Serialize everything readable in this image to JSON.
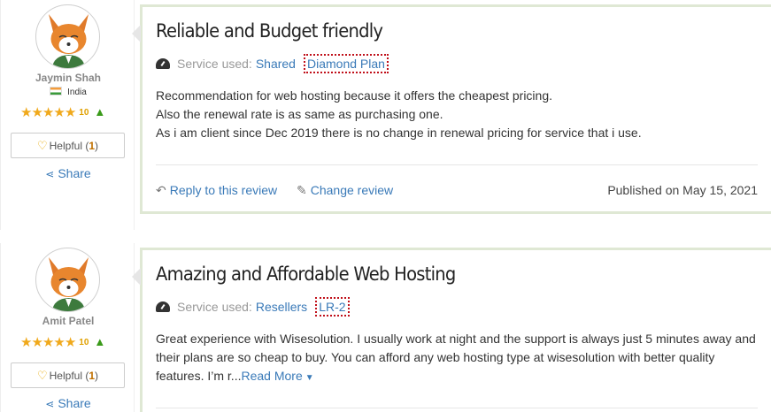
{
  "reviews": [
    {
      "user": {
        "name": "Jaymin Shah",
        "country": "India",
        "rating_count": "10"
      },
      "helpful": {
        "label": "Helpful (",
        "count": "1",
        "close": ")"
      },
      "share_label": "Share",
      "title": "Reliable and Budget friendly",
      "service_label": "Service used:",
      "service_type": "Shared",
      "plan": "Diamond Plan",
      "body": [
        "Recommendation for web hosting because it offers the cheapest pricing.",
        "Also the renewal rate is as same as purchasing one.",
        "As i am client since Dec 2019 there is no change in renewal pricing for service that i use."
      ],
      "reply_label": "Reply to this review",
      "change_label": "Change review",
      "published": "Published on May 15, 2021"
    },
    {
      "user": {
        "name": "Amit Patel",
        "rating_count": "10"
      },
      "helpful": {
        "label": "Helpful (",
        "count": "1",
        "close": ")"
      },
      "share_label": "Share",
      "title": "Amazing and Affordable Web Hosting",
      "service_label": "Service used:",
      "service_type": "Resellers",
      "plan": "LR-2",
      "body_excerpt": "Great experience with Wisesolution. I usually work at night and the support is always just 5 minutes away and their plans are so cheap to buy. You can afford any web hosting type at wisesolution with better quality features. I’m r...",
      "read_more": "Read More"
    }
  ],
  "icons": {
    "star": "★",
    "thumb": "👍",
    "bulb": "💡",
    "share": "✳",
    "reply": "↶",
    "edit": "✎",
    "caret": "▾"
  },
  "colors": {
    "link": "#3a7ab8",
    "star": "#f0a91c",
    "card_border": "#dfe8d4"
  }
}
